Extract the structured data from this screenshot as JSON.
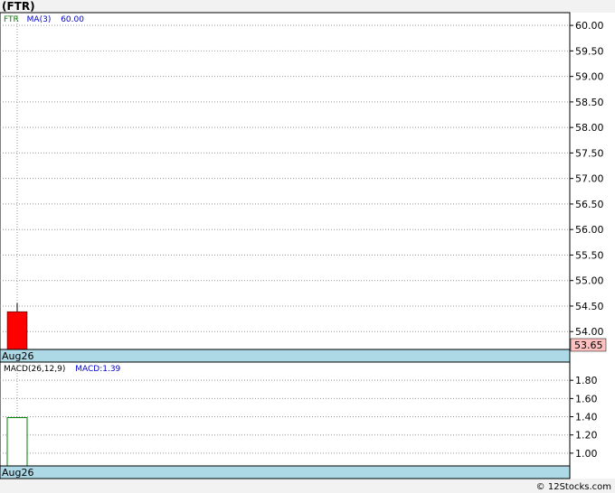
{
  "header": {
    "title": "(FTR)"
  },
  "footer": {
    "credit": "© 12Stocks.com"
  },
  "chart_data": [
    {
      "type": "candlestick",
      "legend": {
        "symbol": "FTR",
        "indicator": "MA(3)",
        "indicator_value": "60.00"
      },
      "x_label": "Aug26",
      "ylim": [
        53.65,
        60.25
      ],
      "yticks": [
        54.0,
        54.5,
        55.0,
        55.5,
        56.0,
        56.5,
        57.0,
        57.5,
        58.0,
        58.5,
        59.0,
        59.5,
        60.0
      ],
      "candles": [
        {
          "date": "Aug26",
          "open": 54.39,
          "close": 53.65,
          "high": 54.56,
          "low": 53.65,
          "color": "#ff0000"
        }
      ],
      "last_price": "53.65",
      "grid": true,
      "colors": {
        "down": "#ff0000",
        "legend_symbol": "#008000",
        "legend_ma": "#0000cc",
        "axis_band": "#add8e6",
        "last_price_bg": "#ffc0c0"
      }
    },
    {
      "type": "bar",
      "legend": {
        "indicator": "MACD(26,12,9)",
        "value_label": "MACD:1.39"
      },
      "x_label": "Aug26",
      "ylim": [
        0.86,
        2.0
      ],
      "yticks": [
        1.0,
        1.2,
        1.4,
        1.6,
        1.8
      ],
      "bars": [
        {
          "date": "Aug26",
          "value": 1.39
        }
      ],
      "grid": true,
      "colors": {
        "bar_fill": "#ffffff",
        "bar_stroke": "#008000",
        "legend_value": "#0000cc"
      }
    }
  ]
}
